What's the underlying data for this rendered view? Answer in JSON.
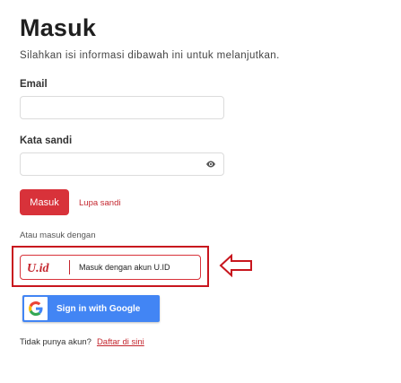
{
  "header": {
    "title": "Masuk",
    "subtitle": "Silahkan isi informasi dibawah ini untuk melanjutkan."
  },
  "form": {
    "email_label": "Email",
    "email_value": "",
    "password_label": "Kata sandi",
    "password_value": "",
    "password_toggle_icon": "eye-icon",
    "login_label": "Masuk",
    "forgot_label": "Lupa sandi"
  },
  "alternatives": {
    "heading": "Atau masuk dengan",
    "uid_logo": "U.id",
    "uid_label": "Masuk dengan akun U.ID",
    "google_label": "Sign in with Google"
  },
  "footer": {
    "prompt": "Tidak punya akun?",
    "signup_label": "Daftar di sini"
  },
  "annotations": {
    "highlight_color": "#c8161e",
    "arrow_icon": "left-arrow-icon"
  },
  "colors": {
    "primary_red": "#d8323a",
    "link_red": "#c4262e",
    "google_blue": "#4285f4"
  }
}
